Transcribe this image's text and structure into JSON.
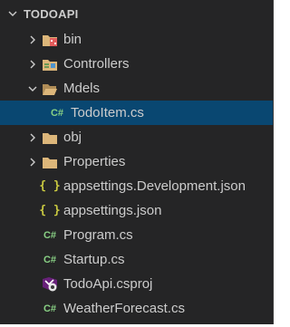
{
  "explorer": {
    "title": "TODOAPI",
    "items": [
      {
        "label": "bin",
        "depth": 0,
        "kind": "folder",
        "expanded": false,
        "icon": "bin-folder-icon"
      },
      {
        "label": "Controllers",
        "depth": 0,
        "kind": "folder",
        "expanded": false,
        "icon": "controllers-folder-icon"
      },
      {
        "label": "Mdels",
        "depth": 0,
        "kind": "folder",
        "expanded": true,
        "icon": "open-folder-icon"
      },
      {
        "label": "TodoItem.cs",
        "depth": 1,
        "kind": "file",
        "icon": "csharp-icon",
        "icon_text": "C#",
        "selected": true
      },
      {
        "label": "obj",
        "depth": 0,
        "kind": "folder",
        "expanded": false,
        "icon": "folder-icon"
      },
      {
        "label": "Properties",
        "depth": 0,
        "kind": "folder",
        "expanded": false,
        "icon": "folder-icon"
      },
      {
        "label": "appsettings.Development.json",
        "depth": 0,
        "kind": "file",
        "icon": "json-icon",
        "icon_text": "{ }"
      },
      {
        "label": "appsettings.json",
        "depth": 0,
        "kind": "file",
        "icon": "json-icon",
        "icon_text": "{ }"
      },
      {
        "label": "Program.cs",
        "depth": 0,
        "kind": "file",
        "icon": "csharp-icon",
        "icon_text": "C#"
      },
      {
        "label": "Startup.cs",
        "depth": 0,
        "kind": "file",
        "icon": "csharp-icon",
        "icon_text": "C#"
      },
      {
        "label": "TodoApi.csproj",
        "depth": 0,
        "kind": "file",
        "icon": "csproj-icon"
      },
      {
        "label": "WeatherForecast.cs",
        "depth": 0,
        "kind": "file",
        "icon": "csharp-icon",
        "icon_text": "C#"
      }
    ]
  },
  "colors": {
    "background": "#252526",
    "selection": "#094771",
    "text": "#cccccc",
    "folder": "#dcb67a",
    "csharp": "#89d185",
    "json": "#cbcb41",
    "bin_icon": "#e25c5c"
  }
}
